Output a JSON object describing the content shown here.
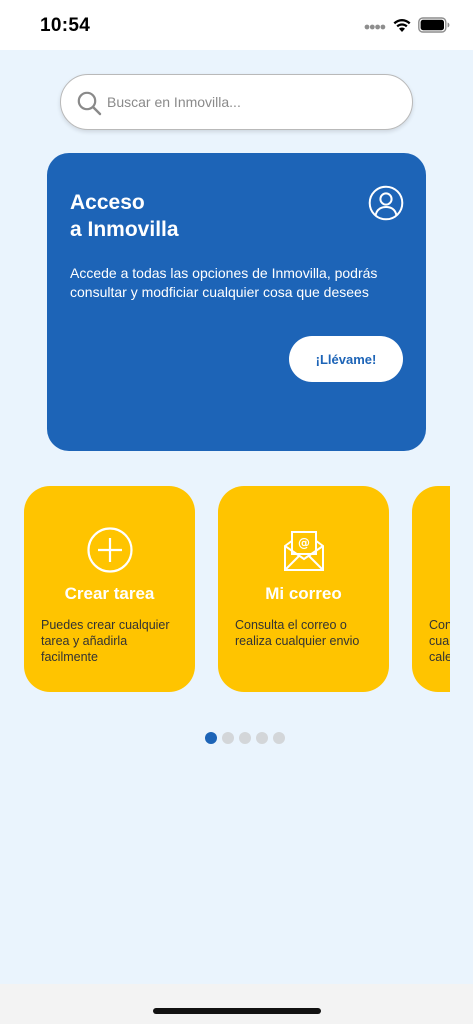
{
  "status_bar": {
    "time": "10:54",
    "icons": [
      "signal-icon",
      "wifi-icon",
      "battery-icon"
    ]
  },
  "search": {
    "placeholder": "Buscar en Inmovilla...",
    "value": "",
    "icon": "search-icon"
  },
  "access_card": {
    "title_line1": "Acceso",
    "title_line2": "a Inmovilla",
    "description": "Accede a todas las opciones de Inmovilla, podrás consultar y modficiar cualquier cosa que desees",
    "button_label": "¡Llévame!",
    "icon": "user-icon",
    "background_color": "#1d64b7"
  },
  "feature_cards": [
    {
      "icon": "plus-circle-icon",
      "title": "Crear tarea",
      "description": "Puedes crear cualquier tarea y añadirla facilmente"
    },
    {
      "icon": "envelope-icon",
      "title": "Mi correo",
      "description": "Consulta el correo o realiza cualquier envio"
    },
    {
      "icon": "",
      "title": "",
      "description": "Con cua cale"
    }
  ],
  "feature_card_color": "#ffc400",
  "pager": {
    "count": 5,
    "active_index": 0
  },
  "colors": {
    "background": "#eaf4fd",
    "accent_blue": "#1d64b7",
    "accent_yellow": "#ffc400"
  }
}
